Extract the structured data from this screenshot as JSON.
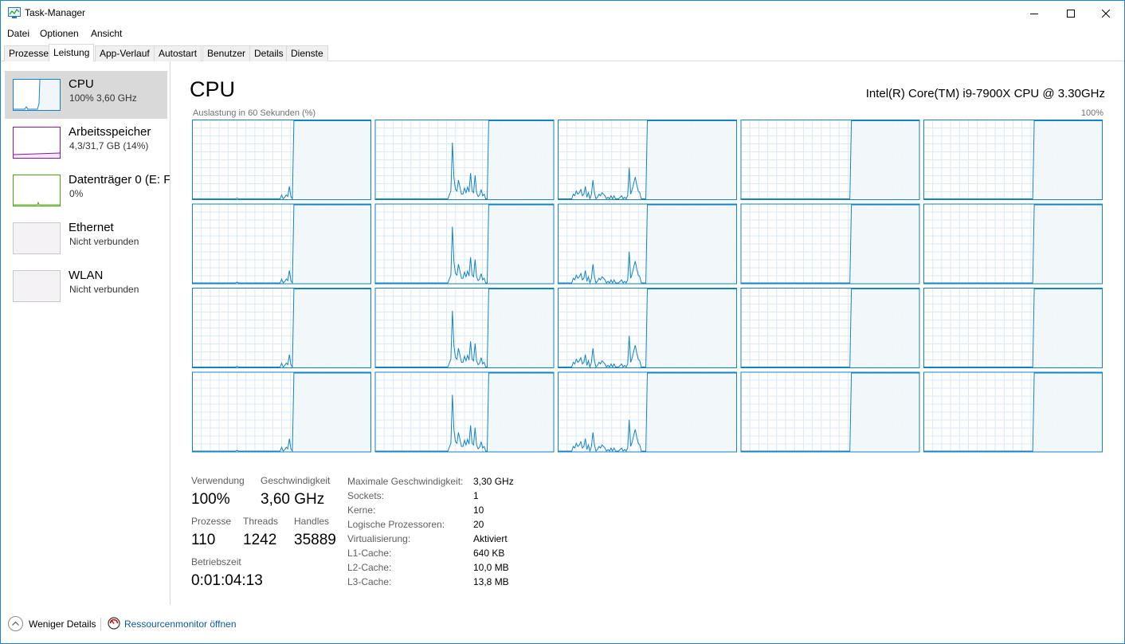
{
  "window": {
    "title": "Task-Manager"
  },
  "menu": [
    "Datei",
    "Optionen",
    "Ansicht"
  ],
  "tabs": [
    "Prozesse",
    "Leistung",
    "App-Verlauf",
    "Autostart",
    "Benutzer",
    "Details",
    "Dienste"
  ],
  "active_tab": "Leistung",
  "sidebar": {
    "items": [
      {
        "title": "CPU",
        "sub": "100%  3,60 GHz",
        "color": "#1183c6",
        "selected": true
      },
      {
        "title": "Arbeitsspeicher",
        "sub": "4,3/31,7 GB (14%)",
        "color": "#8b12ae",
        "selected": false
      },
      {
        "title": "Datenträger 0 (E: F",
        "sub": "0%",
        "color": "#4da60c",
        "selected": false
      },
      {
        "title": "Ethernet",
        "sub": "Nicht verbunden",
        "color": "#c0c0c0",
        "selected": false
      },
      {
        "title": "WLAN",
        "sub": "Nicht verbunden",
        "color": "#c0c0c0",
        "selected": false
      }
    ]
  },
  "main": {
    "title": "CPU",
    "model": "Intel(R) Core(TM) i9-7900X CPU @ 3.30GHz",
    "graph_label": "Auslastung in 60 Sekunden (%)",
    "graph_max": "100%"
  },
  "stats": {
    "usage_label": "Verwendung",
    "usage": "100%",
    "speed_label": "Geschwindigkeit",
    "speed": "3,60 GHz",
    "processes_label": "Prozesse",
    "processes": "110",
    "threads_label": "Threads",
    "threads": "1242",
    "handles_label": "Handles",
    "handles": "35889",
    "uptime_label": "Betriebszeit",
    "uptime": "0:01:04:13"
  },
  "specs": [
    {
      "label": "Maximale Geschwindigkeit:",
      "value": "3,30 GHz"
    },
    {
      "label": "Sockets:",
      "value": "1"
    },
    {
      "label": "Kerne:",
      "value": "10"
    },
    {
      "label": "Logische Prozessoren:",
      "value": "20"
    },
    {
      "label": "Virtualisierung:",
      "value": "Aktiviert"
    },
    {
      "label": "L1-Cache:",
      "value": "640 KB"
    },
    {
      "label": "L2-Cache:",
      "value": "10,0 MB"
    },
    {
      "label": "L3-Cache:",
      "value": "13,8 MB"
    }
  ],
  "footer": {
    "less_details": "Weniger Details",
    "resource_monitor": "Ressourcenmonitor öffnen"
  },
  "colors": {
    "cpu_line": "#1183c6",
    "cpu_fill": "#f1f6fa",
    "grid": "#d9eaf4",
    "accent_border": "#1883d7"
  },
  "chart_data": {
    "type": "line",
    "description_units": "percent utilization over last 60 seconds per logical processor",
    "x_range": [
      60,
      0
    ],
    "ylim": [
      0,
      100
    ],
    "processors": 20,
    "series": [
      {
        "values": [
          0,
          0,
          0,
          0,
          0,
          0,
          0,
          0,
          0,
          0,
          0,
          0,
          0,
          0,
          0,
          0,
          0,
          0,
          0,
          0,
          0,
          0,
          0,
          0,
          0,
          0,
          0,
          0,
          0,
          1,
          0,
          0,
          0,
          0,
          0,
          0,
          0,
          0,
          0,
          0,
          0,
          0,
          0,
          0,
          0,
          0,
          0,
          0,
          0,
          0,
          0,
          0,
          0,
          0,
          0,
          0,
          0,
          0,
          5,
          0,
          2,
          5,
          3,
          16,
          3,
          0,
          100,
          100,
          100,
          100,
          100,
          100,
          100,
          100,
          100,
          100,
          100,
          100,
          100,
          100,
          100,
          100,
          100,
          100,
          100,
          100,
          100,
          100,
          100,
          100,
          100,
          100,
          100,
          100,
          100,
          100,
          100,
          100,
          100,
          100,
          100,
          100,
          100,
          100,
          100,
          100,
          100,
          100,
          100,
          100,
          100,
          100,
          100,
          100,
          100,
          100,
          100
        ]
      },
      {
        "values": [
          0,
          0,
          0,
          0,
          0,
          0,
          0,
          0,
          0,
          0,
          0,
          0,
          0,
          0,
          0,
          0,
          0,
          0,
          0,
          0,
          0,
          0,
          0,
          0,
          0,
          0,
          0,
          0,
          0,
          0,
          0,
          0,
          0,
          0,
          0,
          0,
          0,
          0,
          0,
          0,
          0,
          0,
          0,
          0,
          0,
          0,
          0,
          0,
          0,
          5,
          10,
          72,
          28,
          12,
          10,
          24,
          15,
          6,
          6,
          14,
          8,
          15,
          9,
          33,
          10,
          8,
          30,
          8,
          3,
          5,
          12,
          4,
          6,
          0,
          0,
          100,
          100,
          100,
          100,
          100,
          100,
          100,
          100,
          100,
          100,
          100,
          100,
          100,
          100,
          100,
          100,
          100,
          100,
          100,
          100,
          100,
          100,
          100,
          100,
          100,
          100,
          100,
          100,
          100,
          100,
          100,
          100,
          100,
          100,
          100,
          100,
          100,
          100,
          100,
          100,
          100,
          100,
          100,
          100
        ]
      },
      {
        "values": [
          0,
          0,
          0,
          0,
          0,
          0,
          0,
          0,
          0,
          0,
          6,
          4,
          10,
          6,
          8,
          12,
          4,
          6,
          16,
          2,
          8,
          0,
          6,
          24,
          8,
          0,
          2,
          6,
          4,
          8,
          6,
          4,
          0,
          2,
          0,
          4,
          0,
          4,
          0,
          0,
          0,
          2,
          4,
          0,
          2,
          0,
          4,
          40,
          6,
          12,
          20,
          28,
          18,
          10,
          8,
          0,
          0,
          0,
          0,
          100,
          100,
          100,
          100,
          100,
          100,
          100,
          100,
          100,
          100,
          100,
          100,
          100,
          100,
          100,
          100,
          100,
          100,
          100,
          100,
          100,
          100,
          100,
          100,
          100,
          100,
          100,
          100,
          100,
          100,
          100,
          100,
          100,
          100,
          100,
          100,
          100,
          100,
          100,
          100,
          100,
          100,
          100,
          100,
          100,
          100,
          100,
          100,
          100,
          100,
          100,
          100,
          100,
          100,
          100,
          100,
          100,
          100,
          100,
          100
        ]
      },
      {
        "values": [
          0,
          0,
          0,
          0,
          0,
          0,
          0,
          0,
          0,
          0,
          0,
          0,
          0,
          0,
          0,
          0,
          0,
          0,
          0,
          0,
          0,
          0,
          0,
          0,
          0,
          0,
          0,
          0,
          0,
          0,
          0,
          0,
          0,
          0,
          0,
          0,
          0,
          0,
          0,
          0,
          0,
          0,
          0,
          0,
          0,
          0,
          0,
          0,
          0,
          0,
          0,
          0,
          0,
          0,
          0,
          0,
          0,
          0,
          0,
          0,
          0,
          0,
          0,
          0,
          0,
          0,
          0,
          0,
          0,
          0,
          0,
          0,
          0,
          0,
          0,
          0,
          0,
          0,
          0,
          0,
          0,
          0,
          0,
          0,
          0,
          0,
          0,
          0,
          0,
          0,
          0,
          0,
          0,
          0,
          0,
          0,
          0,
          0,
          0,
          0,
          0,
          0,
          0,
          0,
          0,
          0,
          0,
          0,
          0,
          0,
          0,
          0,
          0,
          0,
          0,
          0,
          0,
          0,
          0
        ]
      },
      {
        "values": [
          0,
          0,
          0,
          0,
          0,
          0,
          0,
          0,
          0,
          0,
          0,
          0,
          0,
          0,
          0,
          0,
          0,
          0,
          0,
          0,
          0,
          0,
          0,
          0,
          0,
          0,
          0,
          0,
          0,
          0,
          0,
          0,
          0,
          0,
          0,
          0,
          0,
          0,
          0,
          0,
          0,
          0,
          0,
          0,
          0,
          0,
          0,
          0,
          0,
          0,
          0,
          0,
          0,
          0,
          0,
          0,
          0,
          0,
          0,
          0,
          0,
          0,
          0,
          0,
          0,
          0,
          0,
          0,
          0,
          0,
          0,
          0,
          0,
          0,
          0,
          0,
          0,
          0,
          0,
          0,
          0,
          0,
          0,
          0,
          0,
          0,
          0,
          0,
          0,
          0,
          0,
          0,
          0,
          0,
          0,
          0,
          0,
          0,
          0,
          0,
          0,
          0,
          0,
          0,
          0,
          0,
          0,
          0,
          0,
          0,
          0,
          0,
          0,
          0,
          0,
          0,
          0,
          0,
          0
        ]
      }
    ]
  }
}
